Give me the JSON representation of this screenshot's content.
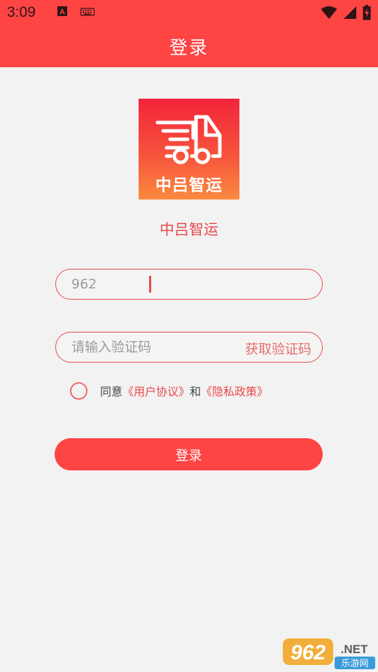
{
  "status_bar": {
    "time": "3:09",
    "icons": [
      "text-a-icon",
      "keyboard-icon",
      "wifi-icon",
      "signal-icon",
      "battery-charging-icon"
    ]
  },
  "header": {
    "title": "登录"
  },
  "logo": {
    "text": "中吕智运",
    "icon": "delivery-truck-icon"
  },
  "app_name": "中吕智运",
  "phone_field": {
    "value": "962",
    "placeholder": ""
  },
  "code_field": {
    "value": "",
    "placeholder": "请输入验证码",
    "get_code_label": "获取验证码"
  },
  "agreement": {
    "prefix": "同意",
    "user_agreement": "《用户协议》",
    "and": "和",
    "privacy_policy": "《隐私政策》",
    "checked": false
  },
  "login_button": {
    "label": "登录"
  },
  "watermark": {
    "main": "962.NET",
    "sub": "乐游网"
  },
  "colors": {
    "primary": "#ff4444",
    "accent_text": "#e9494a",
    "background": "#f3f2f2"
  }
}
